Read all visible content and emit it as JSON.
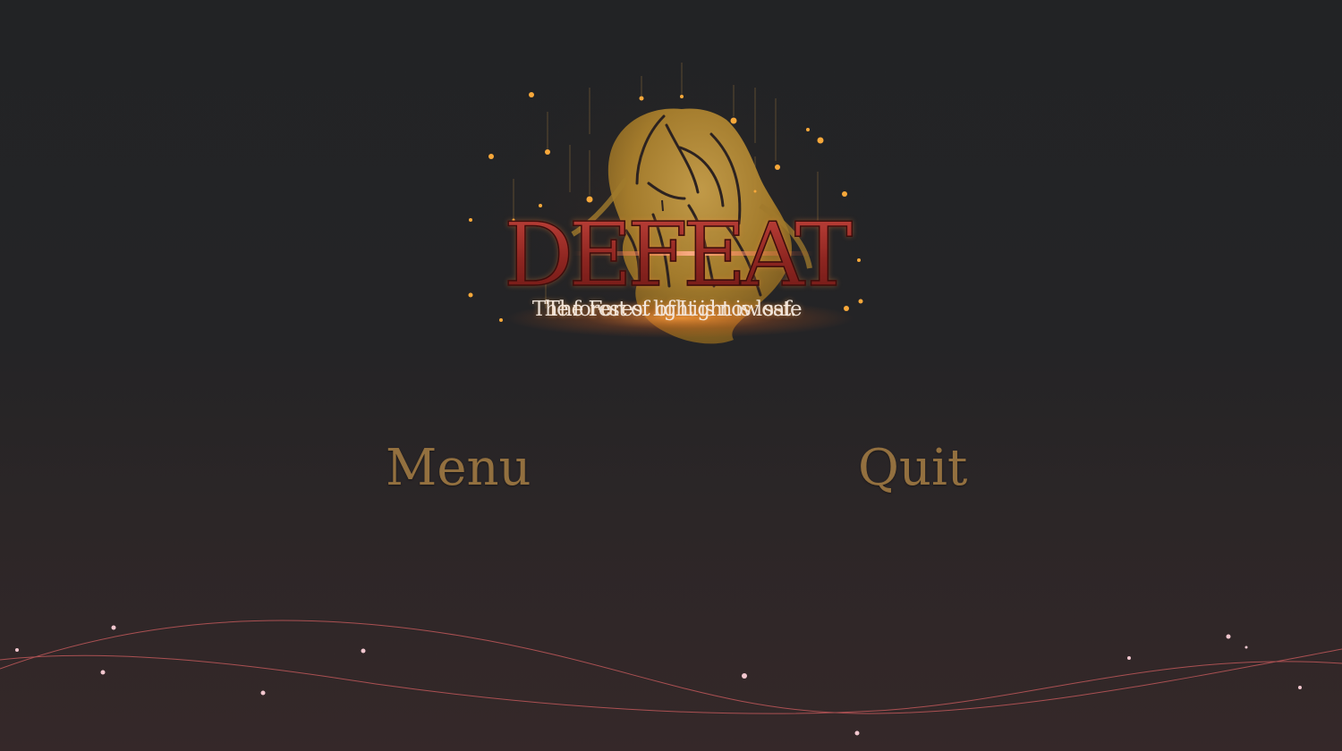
{
  "screen": {
    "title": "DEFEAT",
    "subtitle_primary": "The Forest of Light is lost.",
    "subtitle_secondary": "The forest of light is now safe"
  },
  "buttons": {
    "menu_label": "Menu",
    "quit_label": "Quit"
  },
  "colors": {
    "background_top": "#222325",
    "background_bottom": "#352829",
    "title_red": "#9a2a24",
    "button_gold": "#93703f",
    "emblem_gold": "#b8902f",
    "ember_orange": "#f7a83a",
    "wave_line": "#c0585a"
  },
  "icons": {
    "emblem": "crying-woman-silhouette-icon"
  }
}
